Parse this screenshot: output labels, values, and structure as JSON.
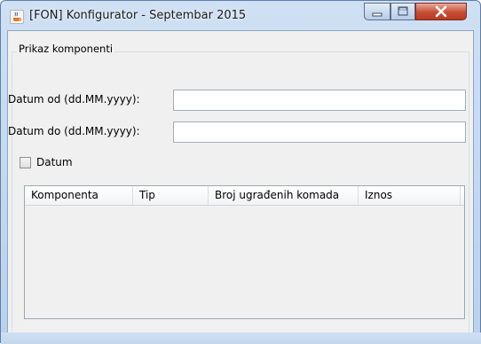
{
  "window": {
    "title": "[FON] Konfigurator - Septembar 2015",
    "app_icon": "java-cup-icon",
    "controls": {
      "minimize_icon": "minimize-icon",
      "maximize_icon": "maximize-icon",
      "close_icon": "close-icon"
    }
  },
  "panel": {
    "title": "Prikaz komponenti"
  },
  "form": {
    "date_from_label": "Datum od (dd.MM.yyyy):",
    "date_from_value": "",
    "date_to_label": "Datum do (dd.MM.yyyy):",
    "date_to_value": "",
    "date_checkbox_label": "Datum",
    "date_checkbox_checked": false
  },
  "table": {
    "columns": [
      "Komponenta",
      "Tip",
      "Broj ugrađenih komada",
      "Iznos"
    ],
    "rows": []
  }
}
